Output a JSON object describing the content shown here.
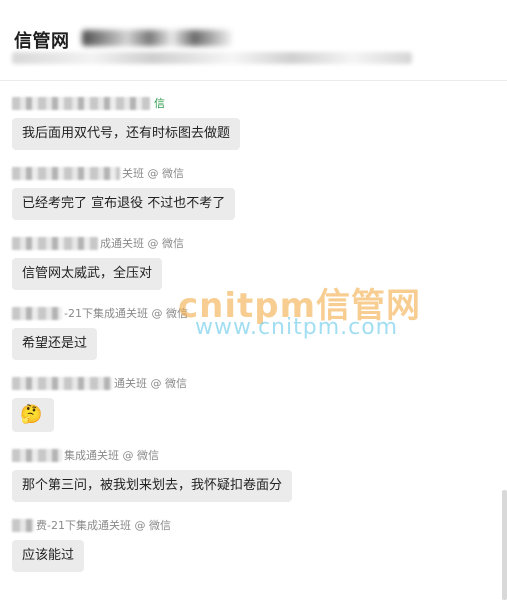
{
  "header": {
    "title": "信管网"
  },
  "messages": [
    {
      "sender_suffix": "信",
      "text": "我后面用双代号，还有时标图去做题"
    },
    {
      "sender_suffix": "关班 @ 微信",
      "text": "已经考完了 宣布退役 不过也不考了"
    },
    {
      "sender_suffix": "成通关班 @ 微信",
      "text": "信管网太威武，全压对"
    },
    {
      "sender_suffix": "-21下集成通关班 @ 微信",
      "text": "希望还是过"
    },
    {
      "sender_suffix": "通关班 @ 微信",
      "emoji": "🤔"
    },
    {
      "sender_suffix": "集成通关班 @ 微信",
      "text": "那个第三问，被我划来划去，我怀疑扣卷面分"
    },
    {
      "sender_suffix": "费-21下集成通关班 @ 微信",
      "text": "应该能过"
    }
  ],
  "watermark": {
    "line1": "cnitpm信管网",
    "line2": "www.cnitpm.com"
  }
}
